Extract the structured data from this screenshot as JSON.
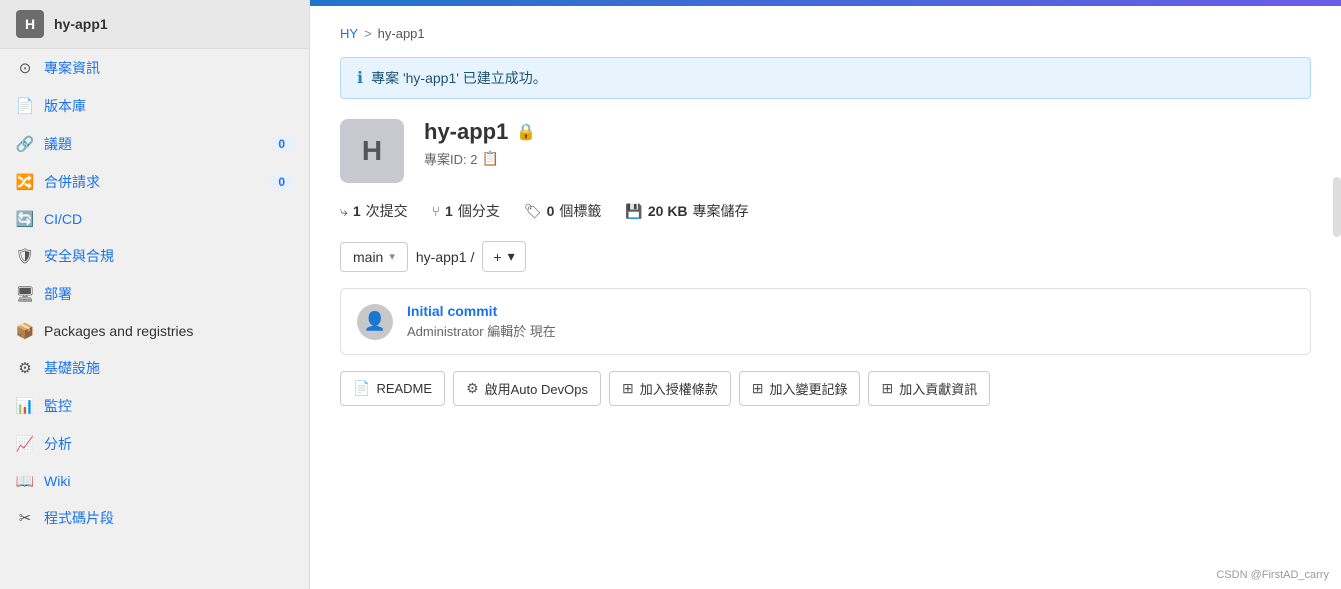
{
  "sidebar": {
    "header": {
      "avatar_letter": "H",
      "title": "hy-app1"
    },
    "items": [
      {
        "id": "project-info",
        "icon": "⊙",
        "label": "專案資訊",
        "badge": null
      },
      {
        "id": "repository",
        "icon": "📄",
        "label": "版本庫",
        "badge": null
      },
      {
        "id": "issues",
        "icon": "🔗",
        "label": "議題",
        "badge": "0"
      },
      {
        "id": "merge-requests",
        "icon": "🔀",
        "label": "合併請求",
        "badge": "0"
      },
      {
        "id": "cicd",
        "icon": "🔄",
        "label": "CI/CD",
        "badge": null
      },
      {
        "id": "security",
        "icon": "🛡",
        "label": "安全與合規",
        "badge": null
      },
      {
        "id": "deploy",
        "icon": "🖥",
        "label": "部署",
        "badge": null
      },
      {
        "id": "packages",
        "icon": "📦",
        "label": "Packages and registries",
        "badge": null
      },
      {
        "id": "infra",
        "icon": "⚙",
        "label": "基礎設施",
        "badge": null
      },
      {
        "id": "monitor",
        "icon": "📊",
        "label": "監控",
        "badge": null
      },
      {
        "id": "analytics",
        "icon": "📈",
        "label": "分析",
        "badge": null
      },
      {
        "id": "wiki",
        "icon": "📖",
        "label": "Wiki",
        "badge": null
      },
      {
        "id": "snippets",
        "icon": "✂",
        "label": "程式碼片段",
        "badge": null
      }
    ]
  },
  "breadcrumb": {
    "parent": "HY",
    "separator": ">",
    "current": "hy-app1"
  },
  "alert": {
    "icon": "ℹ",
    "message": "專案 'hy-app1' 已建立成功。"
  },
  "project": {
    "avatar_letter": "H",
    "name": "hy-app1",
    "lock_icon": "🔒",
    "id_label": "專案ID: 2",
    "copy_icon": "📋",
    "stats": [
      {
        "icon": "⤷",
        "value": "1",
        "label": "次提交"
      },
      {
        "icon": "⑂",
        "value": "1",
        "label": "個分支"
      },
      {
        "icon": "🏷",
        "value": "0",
        "label": "個標籤"
      },
      {
        "icon": "💾",
        "value": "20 KB",
        "label": "專案儲存"
      }
    ]
  },
  "branch_bar": {
    "branch": "main",
    "path": "hy-app1",
    "separator": "/",
    "add_icon": "+",
    "chevron": "▾"
  },
  "commit": {
    "title": "Initial commit",
    "meta": "Administrator 編輯於 現在"
  },
  "action_buttons": [
    {
      "id": "readme",
      "icon": "📄",
      "label": "README"
    },
    {
      "id": "autodevops",
      "icon": "⚙",
      "label": "啟用Auto DevOps"
    },
    {
      "id": "license",
      "icon": "⊞",
      "label": "加入授權條款"
    },
    {
      "id": "changelog",
      "icon": "⊞",
      "label": "加入變更記錄"
    },
    {
      "id": "contributing",
      "icon": "⊞",
      "label": "加入貢獻資訊"
    }
  ],
  "watermark": "CSDN @FirstAD_carry"
}
